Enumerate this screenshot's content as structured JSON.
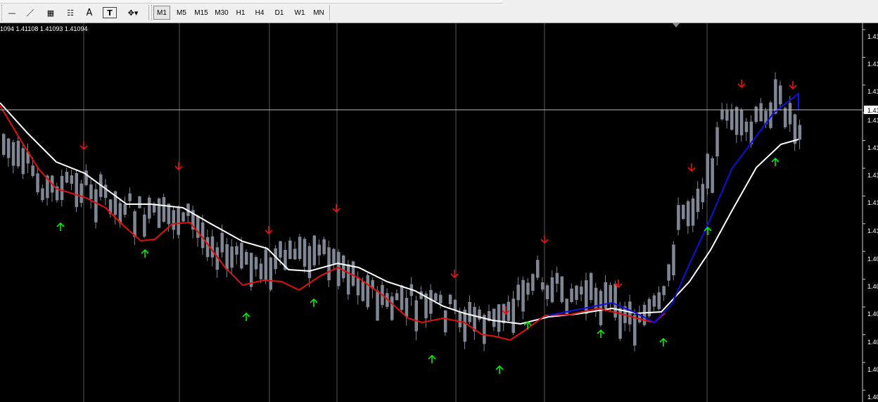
{
  "toolbar": {
    "tools": [
      {
        "name": "horizontal-line-tool",
        "glyph": "—"
      },
      {
        "name": "trendline-tool",
        "glyph": "／"
      },
      {
        "name": "equidistant-channel-tool",
        "glyph": "▦"
      },
      {
        "name": "fibonacci-tool",
        "glyph": "☷"
      },
      {
        "name": "text-tool",
        "glyph": "A"
      },
      {
        "name": "text-label-tool",
        "glyph": "T"
      },
      {
        "name": "arrows-tool",
        "glyph": "✥▾"
      }
    ],
    "timeframes": [
      "M1",
      "M5",
      "M15",
      "M30",
      "H1",
      "H4",
      "D1",
      "W1",
      "MN"
    ],
    "active_timeframe": "M1"
  },
  "chart": {
    "quote_line": "1094 1.41108 1.41093 1.41094",
    "price_labels": [
      "1.41",
      "1.41",
      "1.41",
      "1.41",
      "1.41",
      "1.41",
      "1.41",
      "1.41",
      "1.40",
      "1.40",
      "1.40",
      "1.40",
      "1.40",
      "1.40"
    ],
    "current_price_label": "1.41",
    "colors": {
      "background": "#000000",
      "grid": "#8a8a8a",
      "candle": "#7f8794",
      "ma_fast": "#e01010",
      "ma_slow": "#ffffff",
      "ma_trend": "#1010dd",
      "arrow_up": "#00ee00",
      "arrow_down": "#ee1010"
    }
  }
}
